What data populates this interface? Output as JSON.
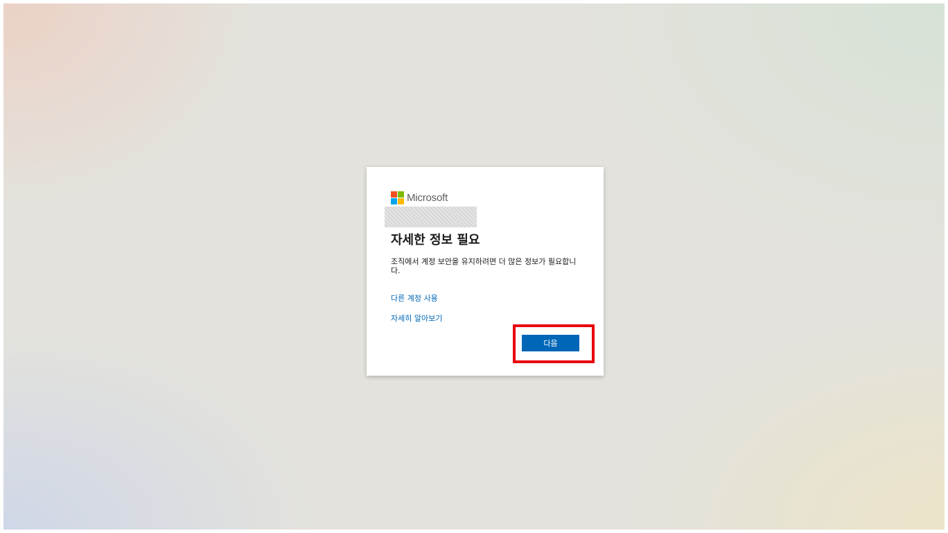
{
  "brand": {
    "name": "Microsoft",
    "logo_colors": [
      "#f25022",
      "#7fba00",
      "#00a4ef",
      "#ffb900"
    ]
  },
  "dialog": {
    "title": "자세한 정보 필요",
    "description": "조직에서 계정 보안을 유지하려면 더 많은 정보가 필요합니다.",
    "link_other_account": "다른 계정 사용",
    "link_learn_more": "자세히 알아보기",
    "next_button": "다음"
  },
  "colors": {
    "accent": "#0067b8",
    "highlight": "#e8000b"
  }
}
